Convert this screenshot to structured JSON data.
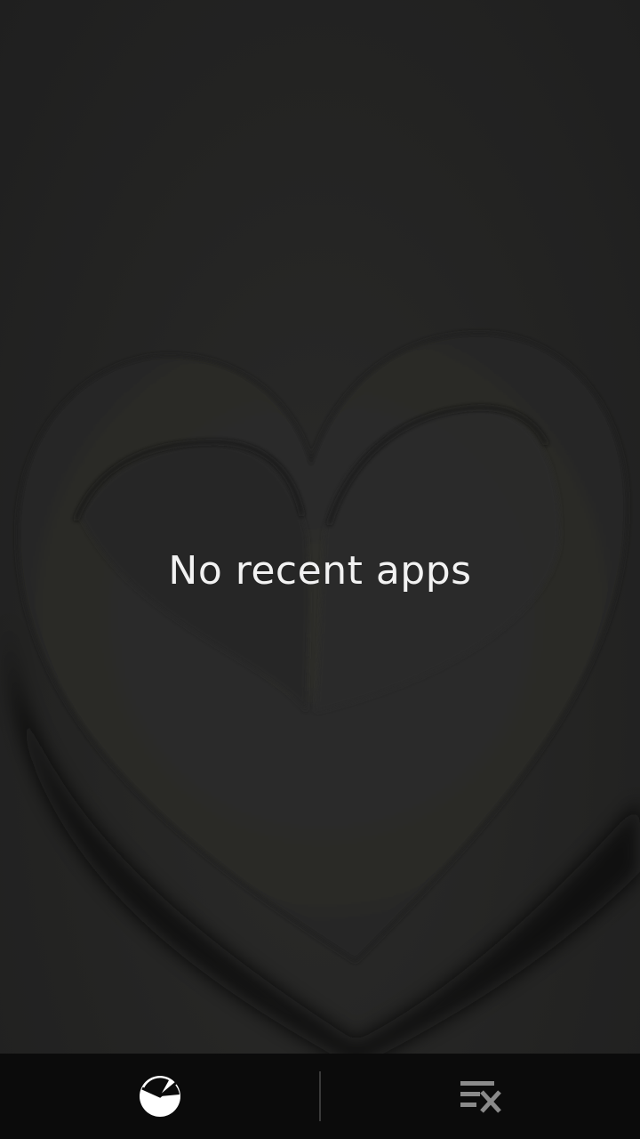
{
  "recents": {
    "empty_message": "No recent apps"
  },
  "bottom_bar": {
    "left_icon": "task-manager-pie-icon",
    "right_icon": "clear-all-icon"
  },
  "colors": {
    "background": "#232323",
    "bar": "#0b0b0b",
    "text": "#f2f2f2"
  }
}
